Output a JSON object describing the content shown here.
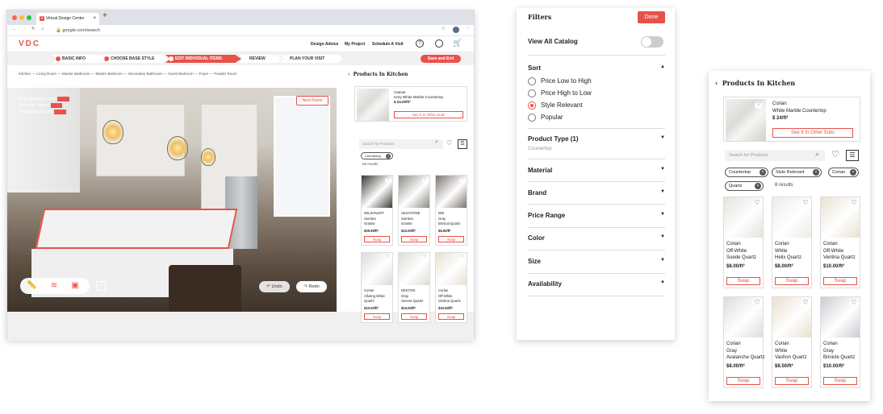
{
  "browser": {
    "tab_title": "Virtual Design Center",
    "url": "google.com/search"
  },
  "app": {
    "logo": "VDC",
    "nav": [
      "Design Advice",
      "My Project",
      "Schedule A Visit"
    ],
    "steps": [
      "BASIC INFO",
      "CHOOSE BASE STYLE",
      "EDIT INDIVIDUAL ITEMS",
      "REVIEW",
      "PLAN YOUR VISIT"
    ],
    "save_label": "Save and Exit",
    "breadcrumb": "Kitchen — Living Room — Master Bathroom — Master Bedroom — Secondary Bathroom — Guest Bedroom — Foyer — Powder Room",
    "overlay": {
      "upgrading_label": "Total upgrading cost:",
      "mortgage_label": "Mortgage impact:",
      "deposit_label": "Immediate Deposit:"
    },
    "next_room": "Next Room",
    "undo": "Undo",
    "redo": "Redo"
  },
  "sidebar": {
    "title": "Products In Kitchen",
    "featured": {
      "brand": "Caesar",
      "name": "Ivory White Marble Countertop",
      "price": "$ 24.00/ft²",
      "button": "See It In Other Suits"
    },
    "search_placeholder": "Search for Products",
    "tag": "Countertop",
    "results": "65 results",
    "products": [
      {
        "brand": "WILSONART",
        "line": "Sombra",
        "name": "Granite",
        "price": "$29.99/ft²",
        "swap": "Swap",
        "color": "#3a3a34"
      },
      {
        "brand": "SILESTONE",
        "line": "Sombra",
        "name": "Granite",
        "price": "$10.00/ft²",
        "swap": "Swap",
        "color": "#8c8a82"
      },
      {
        "brand": "MSI",
        "line": "Gray",
        "name": "Brinical Quartz",
        "price": "$6.00/ft²",
        "swap": "Swap",
        "color": "#7d7470"
      },
      {
        "brand": "Corian",
        "line": "Alluring White",
        "name": "Quartz",
        "price": "$10.00/ft²",
        "swap": "Swap",
        "color": "#d9dadc"
      },
      {
        "brand": "DEKTON",
        "line": "Gray",
        "name": "Serena Quartz",
        "price": "$24.00/ft²",
        "swap": "Swap",
        "color": "#dcdcd6"
      },
      {
        "brand": "Corian",
        "line": "Off-White",
        "name": "Ventina Quartz",
        "price": "$10.00/ft²",
        "swap": "Swap",
        "color": "#e6e0d2"
      }
    ]
  },
  "filters": {
    "title": "Filters",
    "done": "Done",
    "view_all": "View All Catalog",
    "sort_label": "Sort",
    "sort_options": [
      "Price Low to High",
      "Price High to Low",
      "Style Relevant",
      "Popular"
    ],
    "sort_selected": 2,
    "product_type": "Product Type (1)",
    "product_type_value": "Countertop",
    "sections": [
      "Material",
      "Brand",
      "Price Range",
      "Color",
      "Size",
      "Availability"
    ]
  },
  "products_panel": {
    "title": "Products In Kitchen",
    "featured": {
      "brand": "Corian",
      "name": "White Marble Countertop",
      "price": "$ 24/ft²",
      "button": "See It In Other Suits"
    },
    "search_placeholder": "Search for Products",
    "tags": [
      "Countertop",
      "Style Relevant",
      "Corian",
      "Quartz"
    ],
    "results": "8 results",
    "products": [
      {
        "brand": "Corian",
        "line": "Off-White",
        "name": "Suede Quartz",
        "price": "$8.00/ft²",
        "swap": "Swap",
        "color": "#e4e2dc"
      },
      {
        "brand": "Corian",
        "line": "White",
        "name": "Helix Quartz",
        "price": "$8.00/ft²",
        "swap": "Swap",
        "color": "#ecebe6"
      },
      {
        "brand": "Corian",
        "line": "Off-White",
        "name": "Ventina Quartz",
        "price": "$10.00/ft²",
        "swap": "Swap",
        "color": "#e8e2d0"
      },
      {
        "brand": "Corian",
        "line": "Gray",
        "name": "Avalanche Quartz",
        "price": "$8.00/ft²",
        "swap": "Swap",
        "color": "#dddcd8"
      },
      {
        "brand": "Corian",
        "line": "White",
        "name": "Vashon Quartz",
        "price": "$8.50/ft²",
        "swap": "Swap",
        "color": "#eadfcc"
      },
      {
        "brand": "Corian",
        "line": "Gray",
        "name": "Brinicle Quartz",
        "price": "$10.00/ft²",
        "swap": "Swap",
        "color": "#c9ccd2"
      }
    ]
  },
  "colors": {
    "accent": "#e8524a"
  }
}
